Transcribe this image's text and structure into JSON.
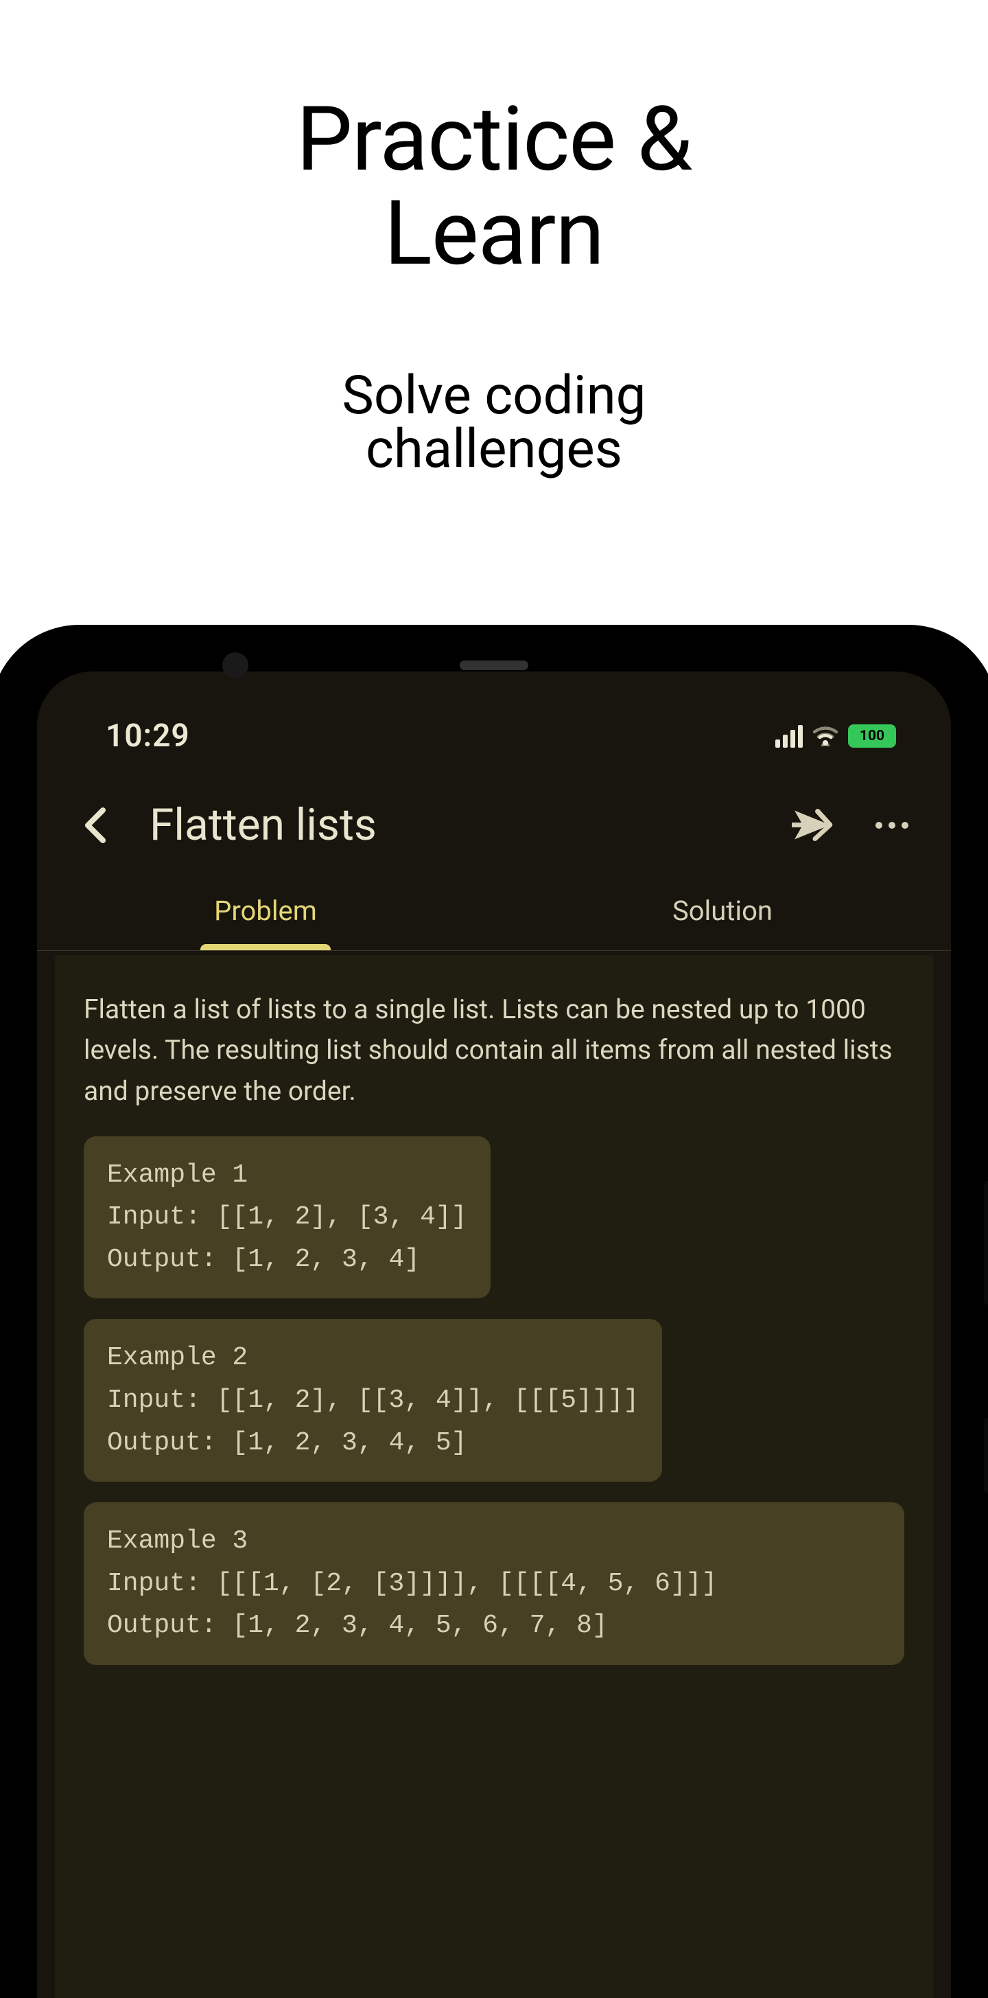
{
  "promo": {
    "title_line1": "Practice &",
    "title_line2": "Learn",
    "subtitle_line1": "Solve coding",
    "subtitle_line2": "challenges"
  },
  "status_bar": {
    "time": "10:29",
    "battery": "100"
  },
  "header": {
    "title": "Flatten lists"
  },
  "tabs": [
    {
      "label": "Problem",
      "active": true
    },
    {
      "label": "Solution",
      "active": false
    }
  ],
  "problem": {
    "description": "Flatten a list of lists to a single list. Lists can be nested up to 1000 levels. The resulting list should contain all items from all nested lists and preserve the order.",
    "examples": [
      "Example 1\nInput: [[1, 2], [3, 4]]\nOutput: [1, 2, 3, 4]",
      "Example 2\nInput: [[1, 2], [[3, 4]], [[[5]]]]\nOutput: [1, 2, 3, 4, 5]",
      "Example 3\nInput: [[[1, [2, [3]]]], [[[[4, 5, 6]]]\nOutput: [1, 2, 3, 4, 5, 6, 7, 8]"
    ]
  }
}
